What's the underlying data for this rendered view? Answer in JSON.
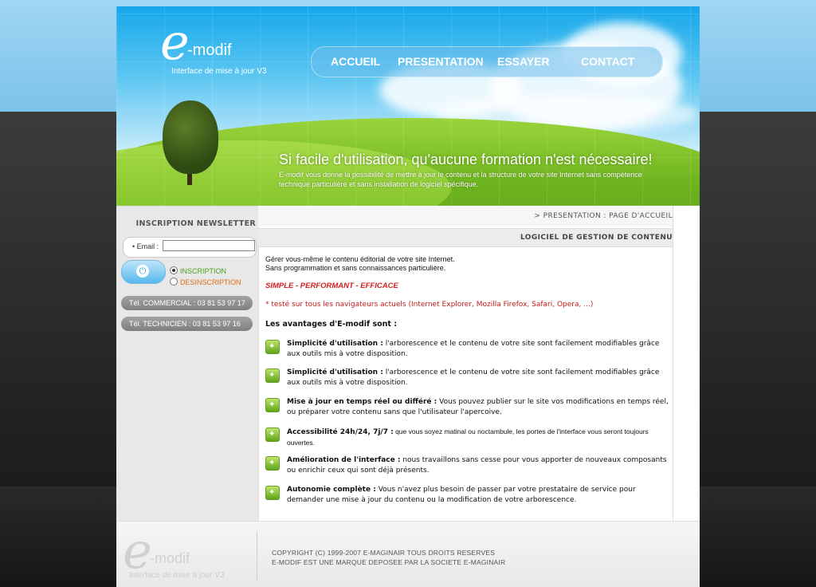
{
  "brand": {
    "logo_letter": "e",
    "logo_name": "-modif",
    "logo_subtitle": "Interface de mise à jour V3"
  },
  "nav": {
    "items": [
      {
        "label": "ACCUEIL"
      },
      {
        "label": "PRESENTATION"
      },
      {
        "label": "ESSAYER"
      },
      {
        "label": "CONTACT"
      }
    ]
  },
  "banner": {
    "tagline": "Si facile d'utilisation, qu'aucune formation n'est nécessaire!",
    "subtext": "E-modif vous donne la possibilité de mettre à jour le contenu et la structure de votre site Internet sans compétence technique particulière et sans installation de logiciel spécifique."
  },
  "newsletter": {
    "title": "INSCRIPTION NEWSLETTER",
    "email_label": "Email :",
    "email_value": "",
    "options": [
      {
        "label": "INSCRIPTION",
        "color": "#4aa31d",
        "selected": true
      },
      {
        "label": "DESINSCRIPTION",
        "color": "#e06b10",
        "selected": false
      }
    ],
    "submit_icon": "power-plug-icon"
  },
  "contacts": [
    {
      "label": "Tél. COMMERCIAL : 03 81 53 97 17"
    },
    {
      "label": "Tél. TECHNICIEN : 03 81 53 97 16"
    }
  ],
  "main": {
    "breadcrumb": "> PRESENTATION : PAGE D'ACCUEIL",
    "section_title": "LOGICIEL DE GESTION DE CONTENU",
    "intro_line1": "Gérer vous-même le contenu éditorial de votre site Internet.",
    "intro_line2": "Sans programmation et sans connaissances particulière.",
    "slogan": "SIMPLE - PERFORMANT - EFFICACE",
    "tested_note": "* testé sur tous les navigateurs actuels (Internet Explorer, Mozilla Firefox, Safari, Opera, ...)",
    "advantages_title": "Les avantages d'E-modif sont :",
    "features": [
      {
        "title": "Simplicité d'utilisation :",
        "text": " l'arborescence et le contenu de votre site sont facilement modifiables grâce aux outils mis à votre disposition."
      },
      {
        "title": "Simplicité d'utilisation :",
        "text": " l'arborescence et le contenu de votre site sont facilement modifiables grâce aux outils mis à votre disposition."
      },
      {
        "title": "Mise à jour en temps réel ou différé :",
        "text": " Vous pouvez publier sur le site vos modifications en temps réel, ou préparer votre contenu sans que l'utilisateur l'apercoive."
      },
      {
        "title": "Accessibilité 24h/24, 7j/7 :",
        "text": "  que vous soyez matinal ou noctambule, les portes de l'interface vous seront toujours ouvertes."
      },
      {
        "title": "Amélioration de l'interface :",
        "text": "  nous travaillons sans cesse pour vous apporter de nouveaux composants ou enrichir ceux qui sont déjà présents."
      },
      {
        "title": "Autonomie complète :",
        "text": " Vous n'avez plus besoin de passer par votre prestataire de service pour demander une mise à jour du contenu ou la modification de votre arborescence."
      }
    ]
  },
  "footer": {
    "copyright": "COPYRIGHT (C) 1999-2007 E-MAGINAIR TOUS DROITS RESERVES",
    "trademark": "E-MODIF EST UNE MARQUE DEPOSEE PAR LA SOCIETE E-MAGINAIR"
  }
}
